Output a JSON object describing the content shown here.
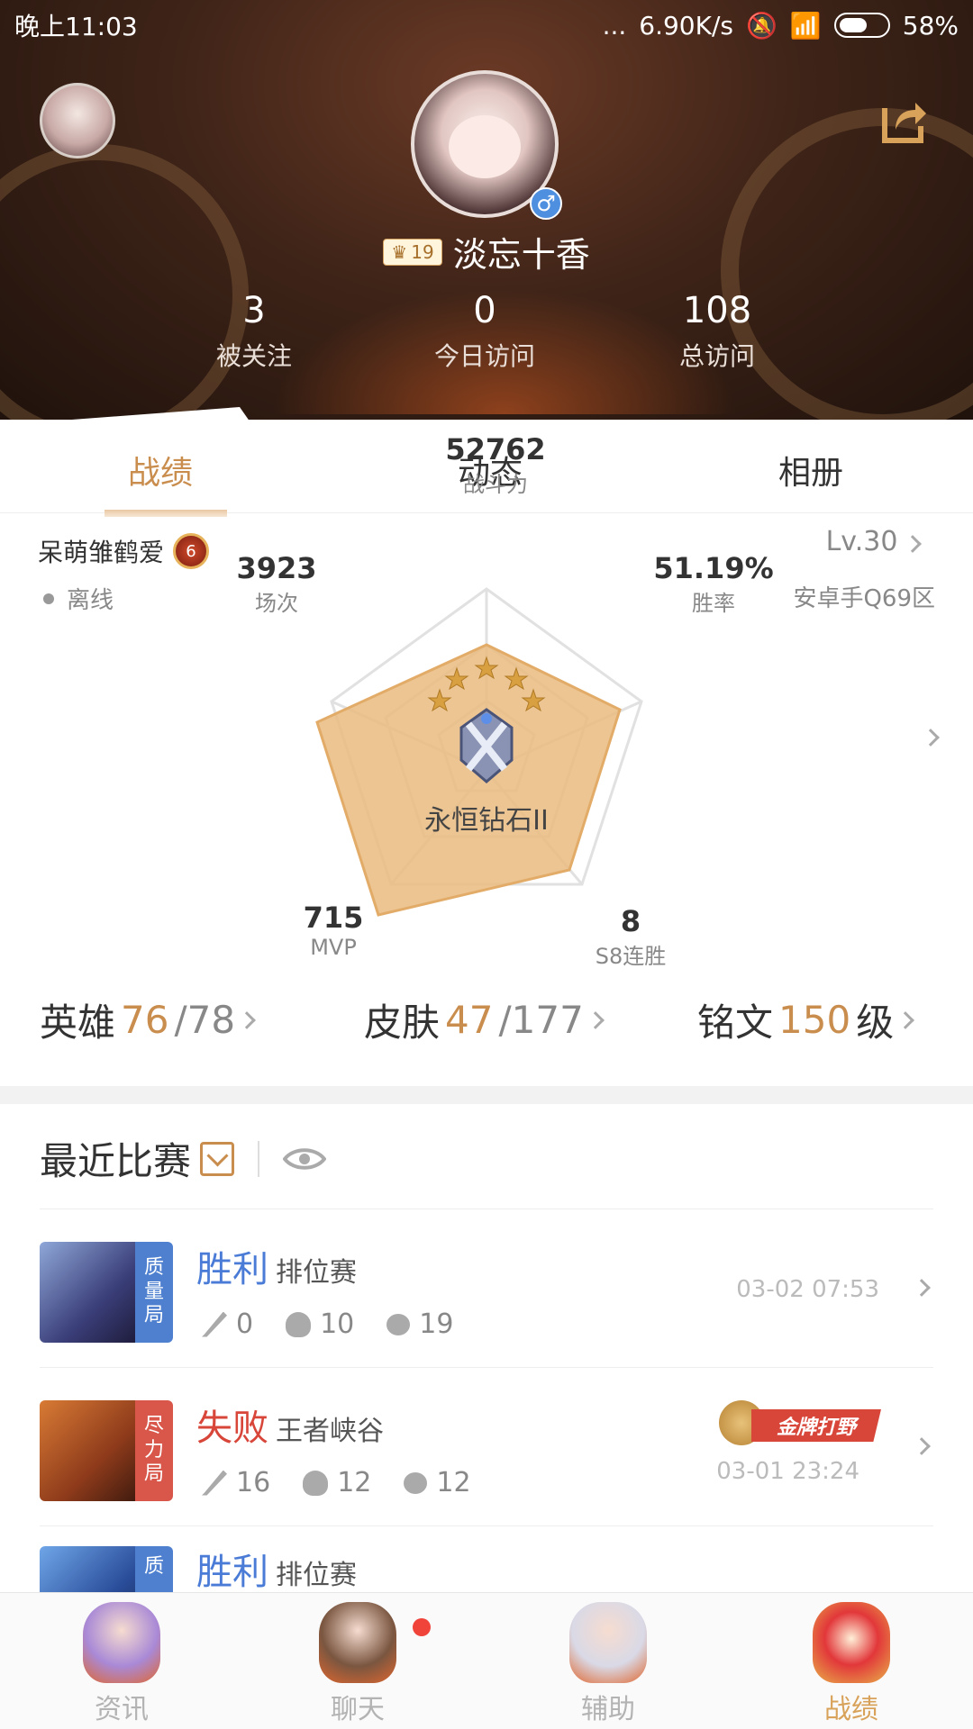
{
  "status_bar": {
    "time": "晚上11:03",
    "dots": "...",
    "speed": "6.90K/s",
    "battery": "58%"
  },
  "profile": {
    "vip_level": "19",
    "username": "淡忘十香",
    "gender_symbol": "♂",
    "stats": [
      {
        "value": "3",
        "label": "被关注"
      },
      {
        "value": "0",
        "label": "今日访问"
      },
      {
        "value": "108",
        "label": "总访问"
      }
    ]
  },
  "tabs": [
    "战绩",
    "动态",
    "相册"
  ],
  "player": {
    "name": "呆萌雏鹤爱",
    "badge_level": "6",
    "status": "离线",
    "level": "Lv.30",
    "zone": "安卓手Q69区"
  },
  "radar": {
    "power": {
      "value": "52762",
      "label": "战斗力"
    },
    "winrate": {
      "value": "51.19%",
      "label": "胜率"
    },
    "streak": {
      "value": "8",
      "label": "S8连胜"
    },
    "mvp": {
      "value": "715",
      "label": "MVP"
    },
    "matches": {
      "value": "3923",
      "label": "场次"
    },
    "rank": "永恒钻石II",
    "stars": 5
  },
  "counts": {
    "heroes_label": "英雄",
    "heroes_owned": "76",
    "heroes_total": "/78",
    "skins_label": "皮肤",
    "skins_owned": "47",
    "skins_total": "/177",
    "runes_label": "铭文",
    "runes_level": "150",
    "runes_unit": "级"
  },
  "recent": {
    "title": "最近比赛",
    "matches": [
      {
        "result": "胜利",
        "mode": "排位赛",
        "tag": "质量局",
        "kills": "0",
        "deaths": "10",
        "assists": "19",
        "time": "03-02 07:53",
        "result_color": "#4a7bd6",
        "tag_color": "#4f80cf"
      },
      {
        "result": "失败",
        "mode": "王者峡谷",
        "tag": "尽力局",
        "kills": "16",
        "deaths": "12",
        "assists": "12",
        "time": "03-01 23:24",
        "medal": "金牌打野",
        "result_color": "#d8463a",
        "tag_color": "#d8574a"
      },
      {
        "result": "胜利",
        "mode": "排位赛",
        "tag": "质",
        "result_color": "#4a7bd6",
        "tag_color": "#4f80cf"
      }
    ]
  },
  "nav": [
    {
      "label": "资讯",
      "icon": "news-mascot-icon"
    },
    {
      "label": "聊天",
      "icon": "chat-mascot-icon"
    },
    {
      "label": "辅助",
      "icon": "assist-mascot-icon"
    },
    {
      "label": "战绩",
      "icon": "record-mascot-icon"
    }
  ]
}
